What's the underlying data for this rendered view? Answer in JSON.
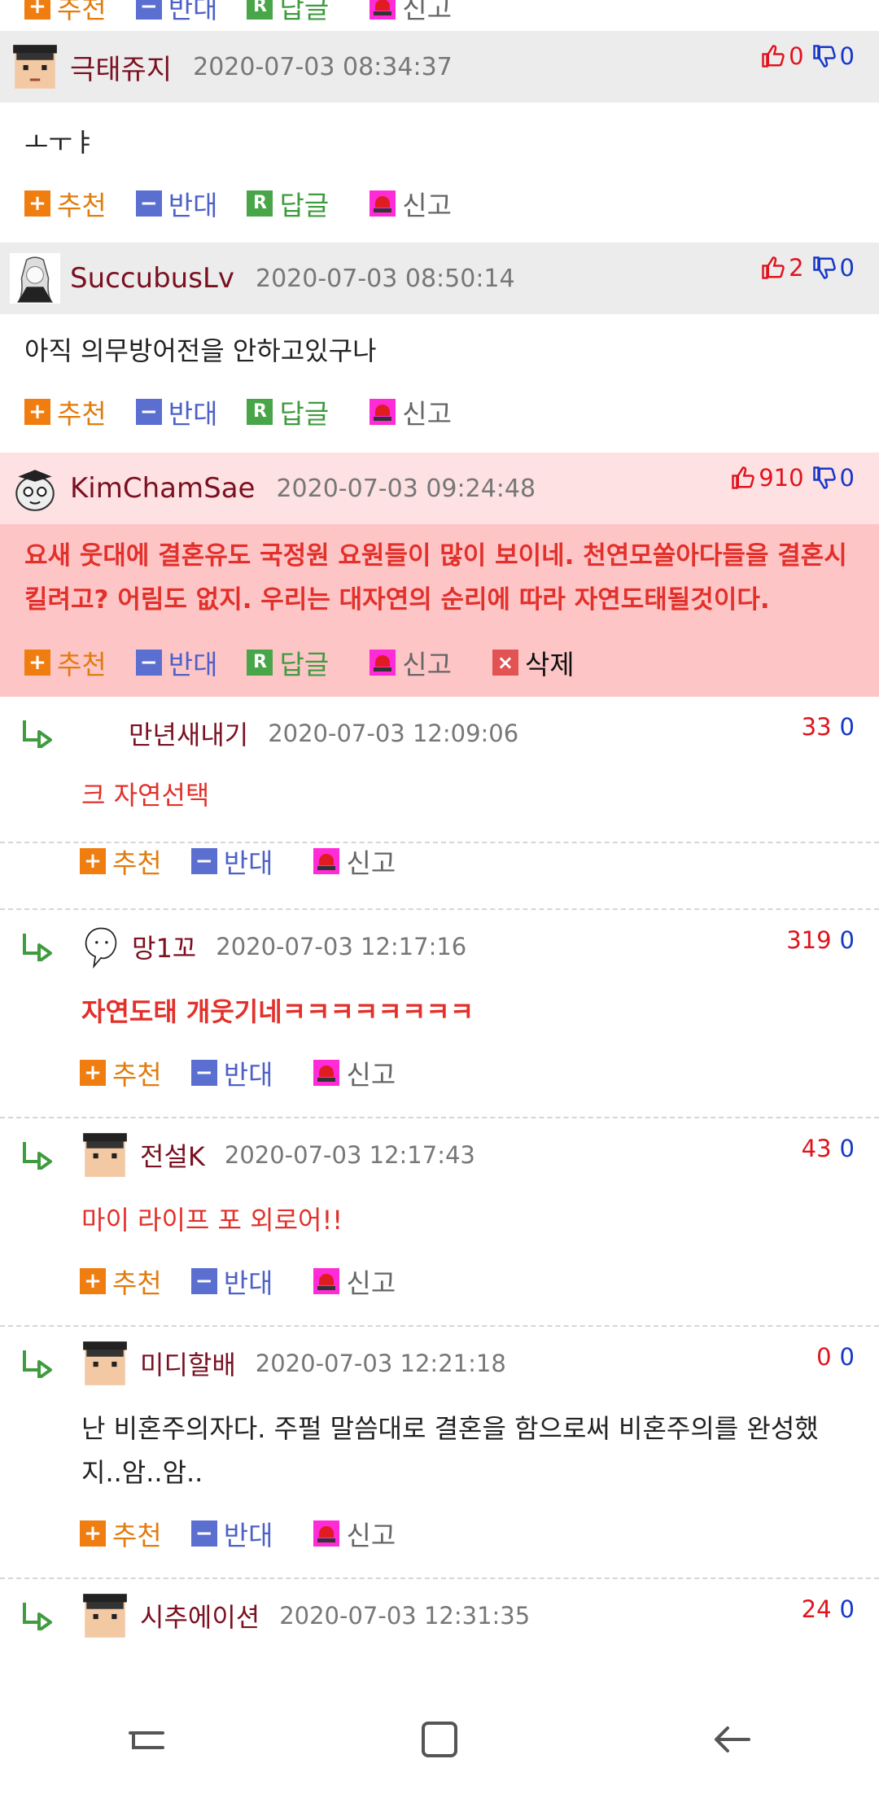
{
  "actions": {
    "upvote": "추천",
    "downvote": "반대",
    "reply": "답글",
    "report": "신고",
    "delete": "삭제"
  },
  "comments": [
    {
      "nickname": "극태쥬지",
      "date": "2020-07-03 08:34:37",
      "up": "0",
      "down": "0",
      "text": "ㅗㅜㅑ"
    },
    {
      "nickname": "SuccubusLv",
      "date": "2020-07-03 08:50:14",
      "up": "2",
      "down": "0",
      "text": "아직 의무방어전을 안하고있구나"
    },
    {
      "nickname": "KimChamSae",
      "date": "2020-07-03 09:24:48",
      "up": "910",
      "down": "0",
      "text": "요새 웃대에 결혼유도 국정원 요원들이 많이 보이네. 천연모쏠아다들을 결혼시킬려고? 어림도 없지. 우리는 대자연의 순리에 따라 자연도태될것이다."
    }
  ],
  "replies": [
    {
      "nickname": "만년새내기",
      "date": "2020-07-03 12:09:06",
      "up": "33",
      "down": "0",
      "text": "크 자연선택"
    },
    {
      "nickname": "망1꼬",
      "date": "2020-07-03 12:17:16",
      "up": "319",
      "down": "0",
      "text": "자연도태 개웃기네ㅋㅋㅋㅋㅋㅋㅋㅋ"
    },
    {
      "nickname": "전설K",
      "date": "2020-07-03 12:17:43",
      "up": "43",
      "down": "0",
      "text": "마이 라이프 포 외로어!!"
    },
    {
      "nickname": "미디할배",
      "date": "2020-07-03 12:21:18",
      "up": "0",
      "down": "0",
      "text": "난 비혼주의자다. 주펄 말씀대로 결혼을 함으로써 비혼주의를 완성했지..암..암.."
    },
    {
      "nickname": "시추에이션",
      "date": "2020-07-03 12:31:35",
      "up": "24",
      "down": "0"
    }
  ],
  "colors": {
    "best_background": "#fec5c7",
    "best_header": "#fde1e3",
    "accent_red": "#e2302a",
    "nick_color": "#7a1020"
  }
}
